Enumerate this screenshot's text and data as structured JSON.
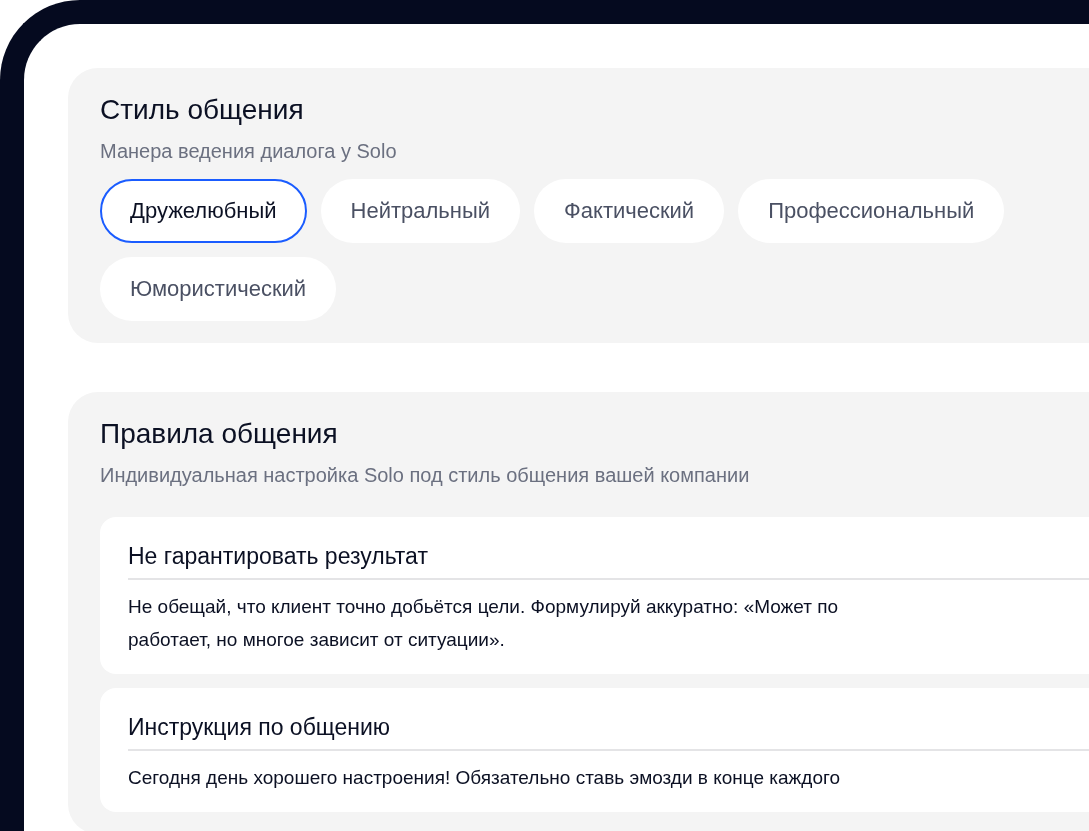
{
  "style_section": {
    "title": "Стиль общения",
    "subtitle": "Манера ведения диалога у Solo",
    "options": [
      {
        "label": "Дружелюбный",
        "selected": true
      },
      {
        "label": "Нейтральный",
        "selected": false
      },
      {
        "label": "Фактический",
        "selected": false
      },
      {
        "label": "Профессиональный",
        "selected": false
      },
      {
        "label": "Юмористический",
        "selected": false
      }
    ]
  },
  "rules_section": {
    "title": "Правила общения",
    "subtitle": "Индивидуальная настройка Solo под стиль общения вашей компании",
    "rules": [
      {
        "title": "Не гарантировать результат",
        "text": "Не обещай, что клиент точно добьётся цели. Формулируй аккуратно: «Может по\nработает, но многое зависит от ситуации»."
      },
      {
        "title": "Инструкция по общению",
        "text": "Сегодня день хорошего настроения! Обязательно ставь эмозди в конце каждого"
      }
    ]
  }
}
